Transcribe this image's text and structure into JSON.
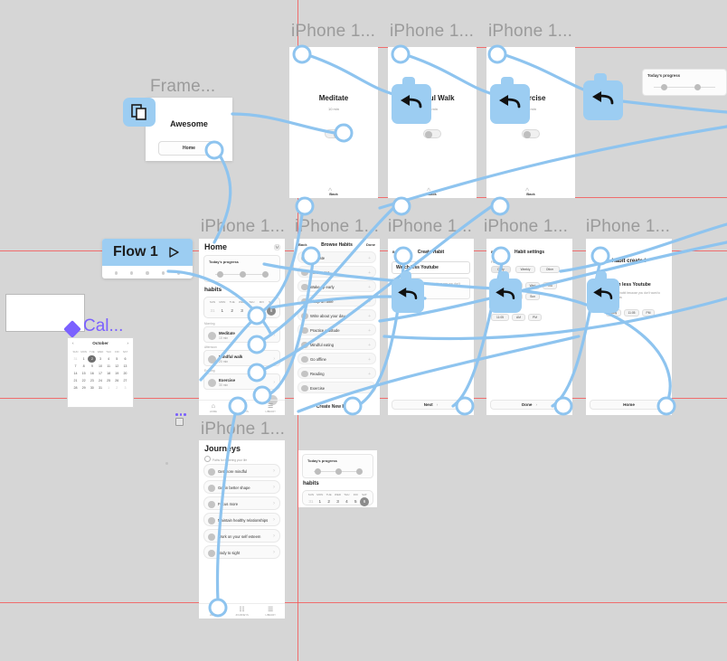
{
  "canvas": {
    "background_color": "#d6d6d6",
    "guide_color": "#f45b5b",
    "wire_color": "#8ec4ef",
    "hotspot_color": "#9ccdf2",
    "accent_purple": "#7b61ff"
  },
  "flow": {
    "name": "Flow 1",
    "play_icon": "play-triangle-icon"
  },
  "labels": {
    "frame_top_left": "Frame...",
    "iphone": "iPhone 1...",
    "calendar_component": "Cal..."
  },
  "awesome_frame": {
    "title": "Awesome",
    "button": "Home",
    "badge_icon": "component-instance-icon"
  },
  "calendar": {
    "prev_icon": "chevron-left-icon",
    "next_icon": "chevron-right-icon",
    "month": "October",
    "weekdays": [
      "SUN",
      "MON",
      "TUE",
      "WED",
      "THU",
      "FRI",
      "SAT"
    ],
    "weeks": [
      [
        "31",
        "1",
        "2",
        "3",
        "4",
        "5",
        "6"
      ],
      [
        "7",
        "8",
        "9",
        "10",
        "11",
        "12",
        "13"
      ],
      [
        "14",
        "15",
        "16",
        "17",
        "18",
        "19",
        "20"
      ],
      [
        "21",
        "22",
        "23",
        "24",
        "25",
        "26",
        "27"
      ],
      [
        "28",
        "29",
        "30",
        "31",
        "1",
        "2",
        "3"
      ]
    ],
    "selected_day": "2",
    "muted_first": "31",
    "muted_tail": [
      "1",
      "2",
      "3"
    ]
  },
  "detail_screens": [
    {
      "title": "Meditate",
      "duration": "10 min",
      "toggle_on": true,
      "back_label": "Back",
      "scroll_icon": "chevron-up-icon"
    },
    {
      "title": "Mindful Walk",
      "duration": "20 min",
      "toggle_on": false,
      "back_label": "Back",
      "scroll_icon": "chevron-up-icon"
    },
    {
      "title": "Exercise",
      "duration": "30 min",
      "toggle_on": false,
      "back_label": "Back",
      "scroll_icon": "chevron-up-icon"
    }
  ],
  "home_screen": {
    "title": "Home",
    "menu_icon": "menu-icon",
    "progress": {
      "label": "Today's progress",
      "dots": 3
    },
    "habits_heading": "habits",
    "weekdays": [
      "SUN",
      "MON",
      "TUE",
      "WED",
      "THU",
      "FRI",
      "SAT"
    ],
    "weeknums": [
      "31",
      "1",
      "2",
      "3",
      "4",
      "5",
      "6"
    ],
    "selected_index": 6,
    "sections": [
      {
        "period": "Morning",
        "name": "Meditate",
        "duration": "10 min"
      },
      {
        "period": "Afternoon",
        "name": "Mindful walk",
        "duration": "20 min"
      },
      {
        "period": "Evening",
        "name": "Exercise",
        "duration": "30 min"
      }
    ],
    "tabs": [
      {
        "label": "HOME",
        "icon": "home-icon",
        "glyph": "⌂"
      },
      {
        "label": "JOURNEYS",
        "icon": "journeys-icon",
        "glyph": "☷"
      },
      {
        "label": "LIBRARY",
        "icon": "library-icon",
        "glyph": "☰"
      }
    ]
  },
  "all_habits_screen": {
    "back_label": "Back",
    "title": "Browse Habits",
    "done_label": "Done",
    "items": [
      "Meditate",
      "Drink water",
      "Wake up early",
      "Sleep on time",
      "Write about your day",
      "Practice gratitude",
      "Mindful eating",
      "Go offline",
      "Reading",
      "Exercise"
    ],
    "add_icon": "plus-icon",
    "cta": "Create New Habit +"
  },
  "new_habit_screen": {
    "back_label": "Back",
    "title": "Create Habit",
    "input_value": "Watch less Youtube",
    "hint": "Choose a habit you want to build or one you don't want to do",
    "next_label": "Next",
    "next_icon": "chevron-right-icon"
  },
  "habit_settings_screen": {
    "back_label": "Back",
    "title": "Habit settings",
    "frequency_label": "Frequency",
    "frequency_options": [
      "Daily",
      "Weekly",
      "Other"
    ],
    "frequency_selected": "Daily",
    "days": [
      "Mon",
      "Tue",
      "Wed",
      "Thu",
      "Fri",
      "Sat",
      "Sun"
    ],
    "time_value": "11:05",
    "am_label": "AM",
    "pm_label": "PM",
    "done_label": "Done",
    "done_icon": "chevron-right-icon"
  },
  "habit_created_screen": {
    "title": "Habit created",
    "habit_name": "Watch less Youtube",
    "description": "You choose this habit because you don't want to spend time on this",
    "chips": [
      "Daily",
      "11:05",
      "PM"
    ],
    "home_label": "Home"
  },
  "progress_card_standalone": {
    "label": "Today's progress",
    "dots": 3
  },
  "mini_home_frame": {
    "progress_label": "Today's progress",
    "dots": 3,
    "habits_heading": "habits",
    "weekdays": [
      "SUN",
      "MON",
      "TUE",
      "WED",
      "THU",
      "FRI",
      "SAT"
    ],
    "weeknums": [
      "31",
      "1",
      "2",
      "3",
      "4",
      "5",
      "6"
    ],
    "selected_index": 6
  },
  "journeys_screen": {
    "title": "Journeys",
    "subtitle": "Paths for bettering your life",
    "info_icon": "info-icon",
    "items": [
      "Get more mindful",
      "Get in better shape",
      "Focus more",
      "Maintain healthy relationships",
      "Work on your self esteem",
      "Body to sight"
    ],
    "tabs": [
      {
        "label": "HOME",
        "icon": "home-icon",
        "glyph": "⌂"
      },
      {
        "label": "JOURNEYS",
        "icon": "journeys-icon",
        "glyph": "☷"
      },
      {
        "label": "LIBRARY",
        "icon": "library-icon",
        "glyph": "☰"
      }
    ]
  }
}
